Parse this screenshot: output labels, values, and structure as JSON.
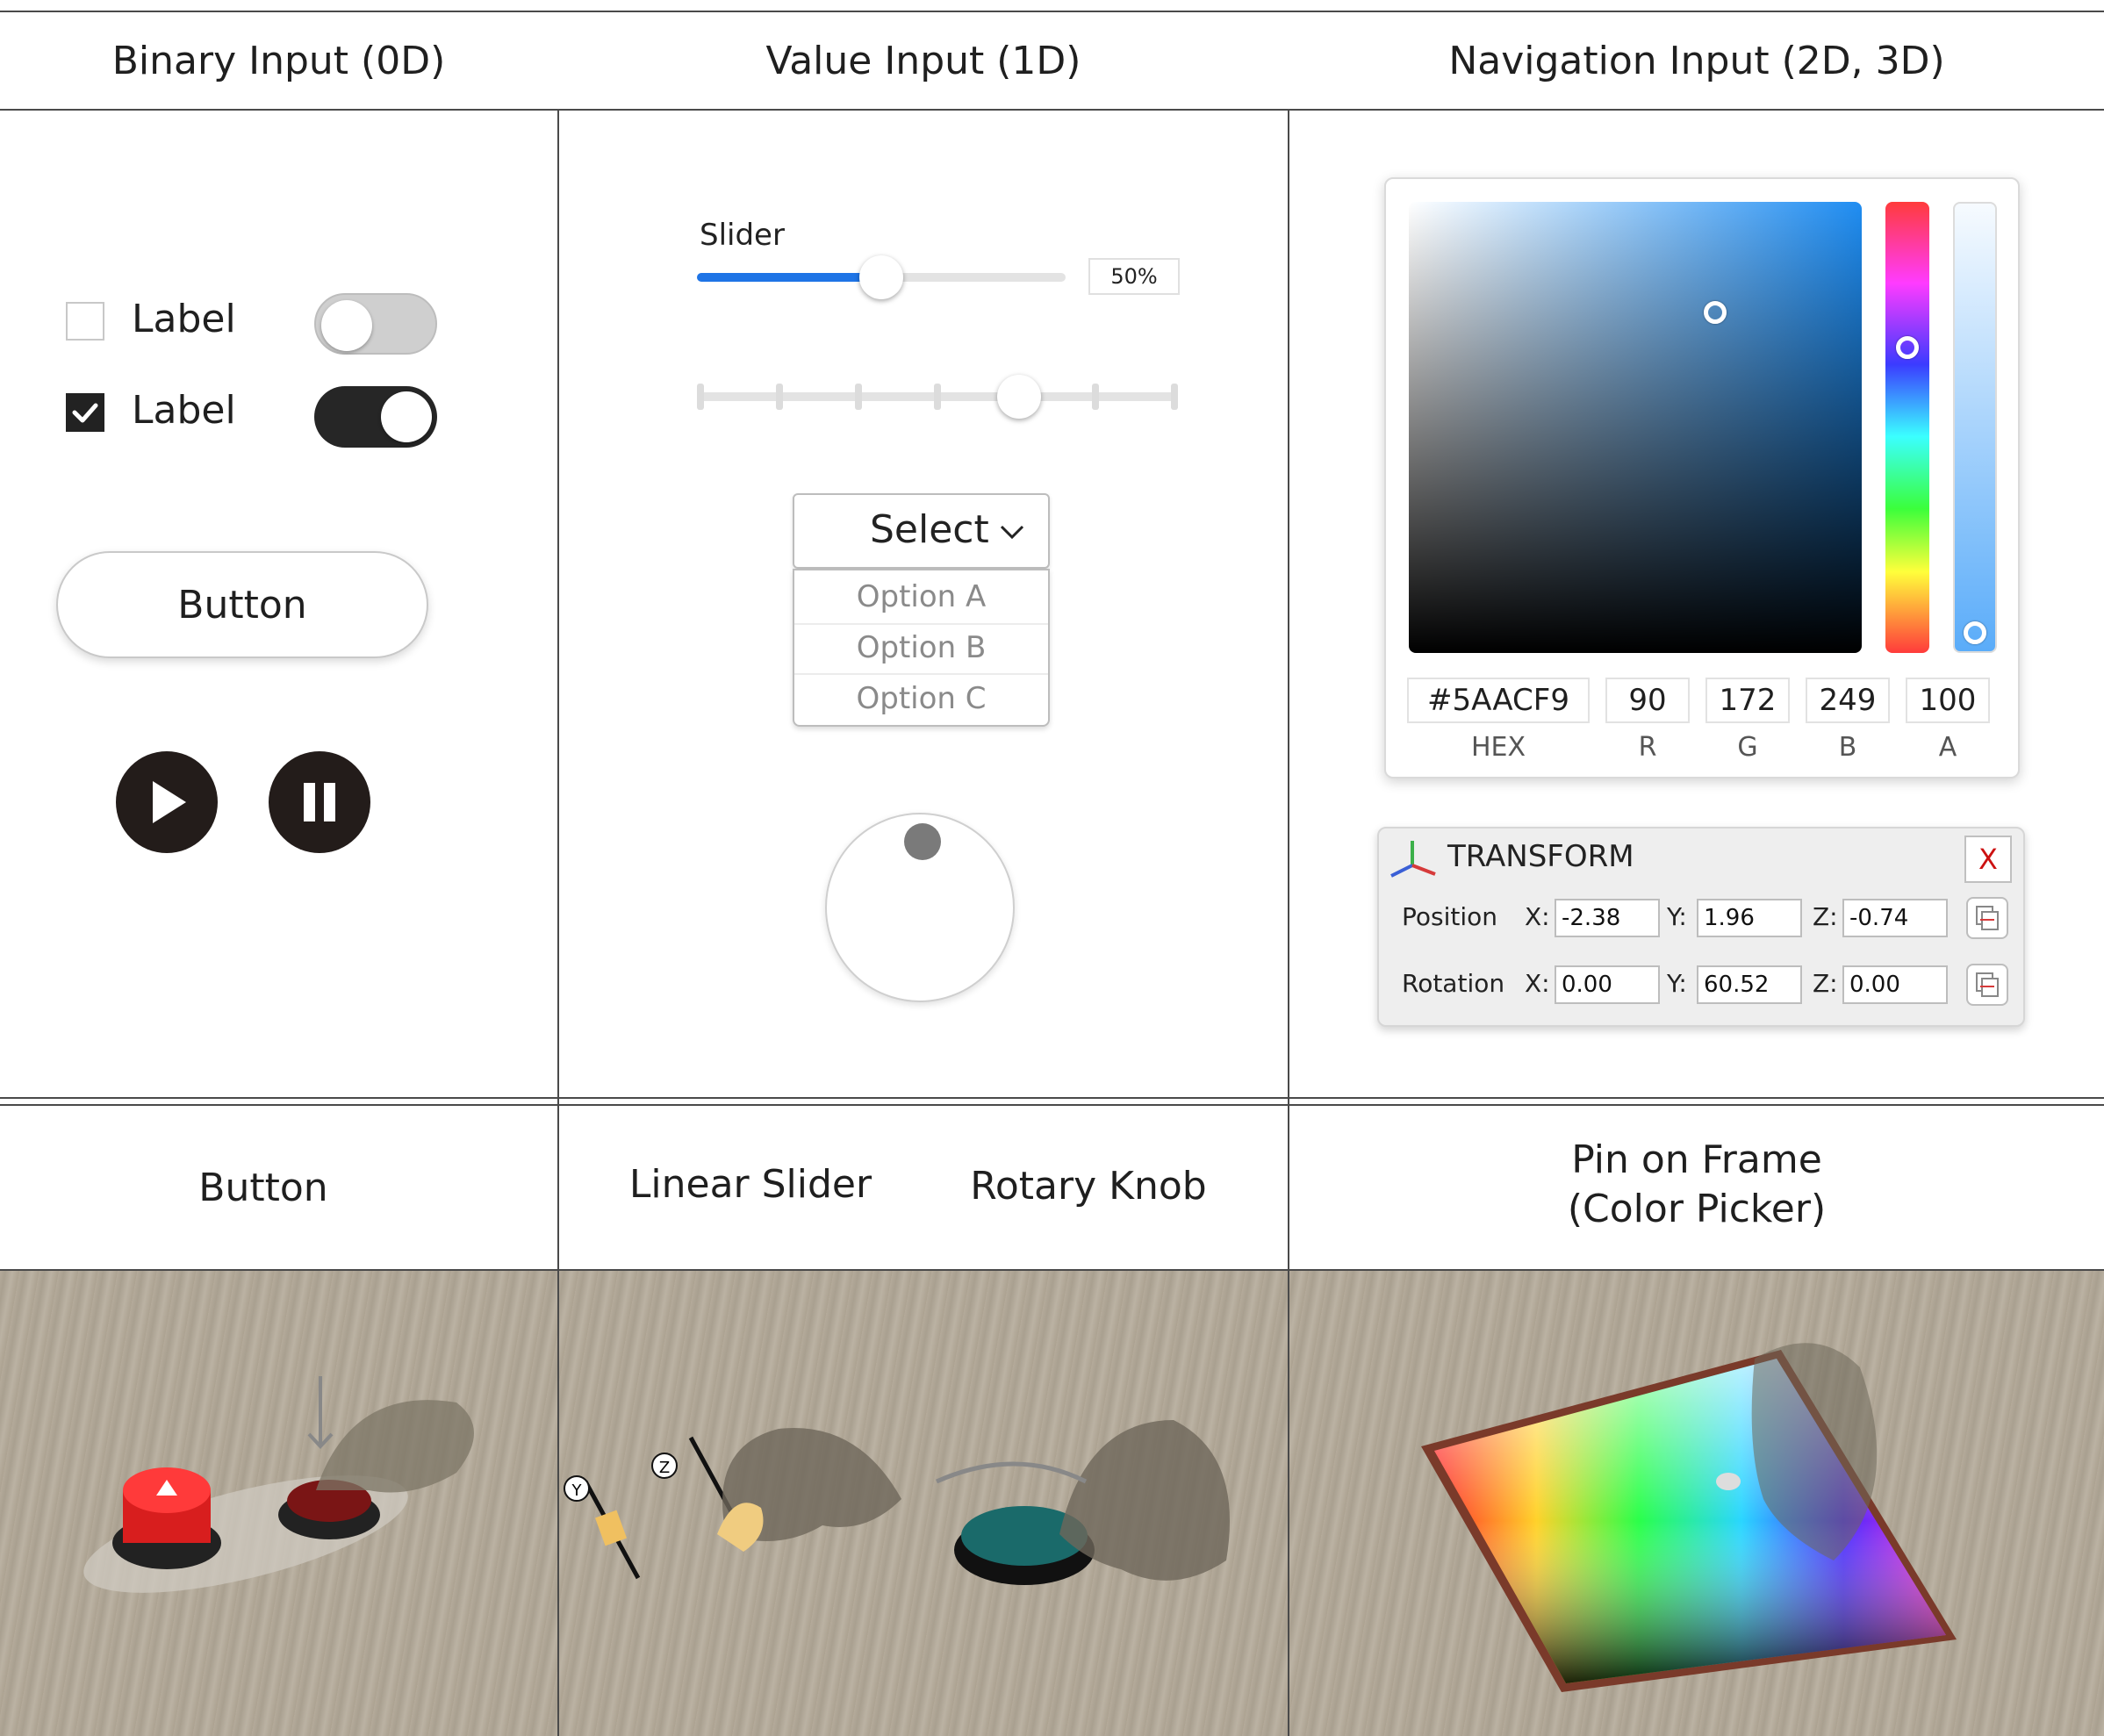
{
  "headers": {
    "binary": "Binary Input (0D)",
    "value": "Value Input (1D)",
    "navigation": "Navigation Input (2D, 3D)"
  },
  "binary_input": {
    "checkbox_label_1": "Label",
    "checkbox_label_2": "Label",
    "button_label": "Button"
  },
  "value_input": {
    "slider_label": "Slider",
    "slider_value_text": "50%",
    "slider_value": 0.5,
    "stepped_slider_value": 0.67,
    "select_label": "Select",
    "options": [
      "Option A",
      "Option B",
      "Option C"
    ]
  },
  "color_picker": {
    "hex": "#5AACF9",
    "r": "90",
    "g": "172",
    "b": "249",
    "a": "100",
    "hex_label": "HEX",
    "r_label": "R",
    "g_label": "G",
    "b_label": "B",
    "a_label": "A"
  },
  "transform": {
    "title": "TRANSFORM",
    "close_label": "X",
    "position_label": "Position",
    "rotation_label": "Rotation",
    "axis_x": "X:",
    "axis_y": "Y:",
    "axis_z": "Z:",
    "position": {
      "x": "-2.38",
      "y": "1.96",
      "z": "-0.74"
    },
    "rotation": {
      "x": "0.00",
      "y": "60.52",
      "z": "0.00"
    }
  },
  "captions": {
    "button": "Button",
    "linear_slider": "Linear Slider",
    "rotary_knob": "Rotary Knob",
    "pin_on_frame_1": "Pin on Frame",
    "pin_on_frame_2": "(Color Picker)"
  },
  "photo_labels": {
    "y": "Y",
    "z": "Z"
  },
  "colors": {
    "accent": "#1e74e6",
    "dark": "#231c1a",
    "picked": "#5AACF9",
    "close_red": "#cc1111"
  },
  "icons": [
    "check-icon",
    "play-icon",
    "pause-icon",
    "chevron-down-icon",
    "axis-gizmo-icon",
    "close-icon",
    "copy-icon"
  ]
}
